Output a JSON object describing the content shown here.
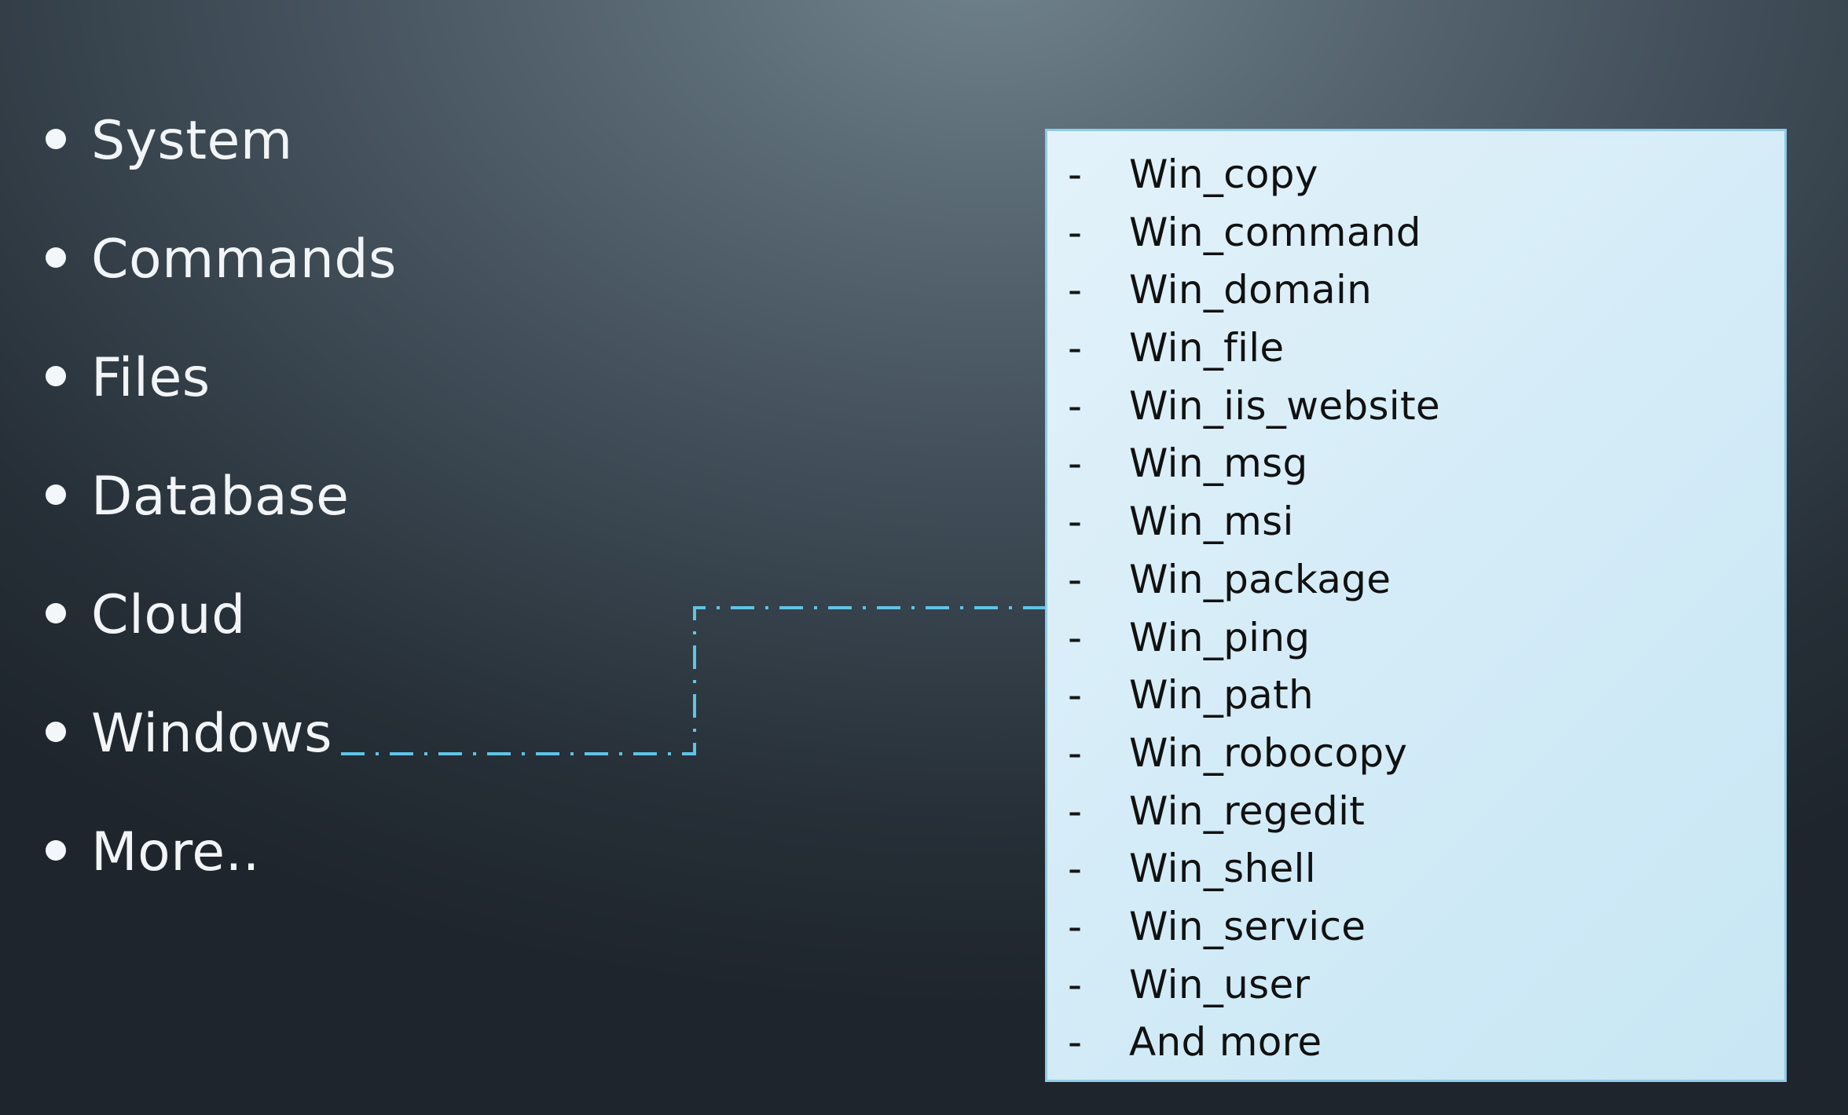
{
  "bullets": [
    "System",
    "Commands",
    "Files",
    "Database",
    "Cloud",
    "Windows",
    "More.."
  ],
  "panel": {
    "dash": "-",
    "items": [
      "Win_copy",
      "Win_command",
      "Win_domain",
      "Win_file",
      "Win_iis_website",
      "Win_msg",
      "Win_msi",
      "Win_package",
      "Win_ping",
      "Win_path",
      "Win_robocopy",
      "Win_regedit",
      "Win_shell",
      "Win_service",
      "Win_user",
      "And more"
    ]
  },
  "colors": {
    "connector": "#5fc4e6",
    "panel_border": "#8fcbe6"
  }
}
